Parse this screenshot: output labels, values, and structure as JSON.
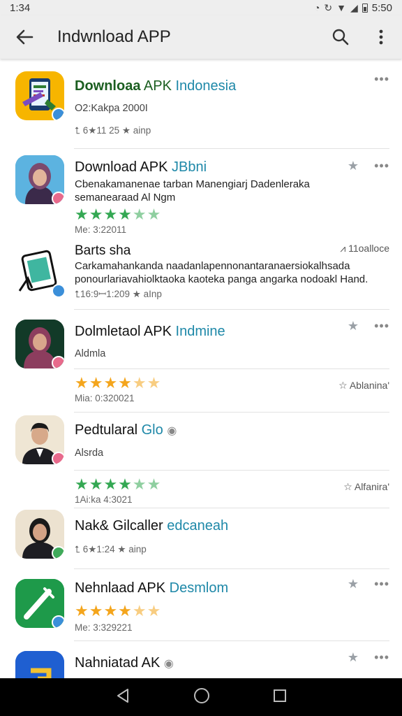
{
  "status_bar": {
    "time": "1:34",
    "clock": "5:50"
  },
  "app_bar": {
    "title": "Indwnload APP"
  },
  "items": [
    {
      "title_a": "Downloaa",
      "title_b": " APK ",
      "title_c": "Indonesia",
      "sub": "O2:Kakpa 2000I",
      "meta": "⮤ 6★11 25  ★ ainp"
    },
    {
      "title_a": "Download APK ",
      "title_b": "JBbni",
      "desc1": "Cbenakamanenae tarban Manengiarj Dadenleraka",
      "desc2": "semanearaad Al Ngm",
      "rating_text": "Me: 3:22011"
    },
    {
      "title": "Barts sha",
      "tag": "⩘ 11oalloce",
      "desc1": "Carkamahankanda naadanlapennonantaranaersiokalhsada",
      "desc2": "ponourlariavahiolktaoka kaoteka panga angarka nodoakl Hand.",
      "meta": "⮤16:9ꟷ1:209 ★ aInp"
    },
    {
      "title_a": "Dolmletaol APK ",
      "title_b": "Indmine",
      "sub": "Aldmla",
      "rating_text": "Mia: 0:320021",
      "tag": "☆ Ablanina'"
    },
    {
      "title_a": "Pedtularal ",
      "title_b": "Glo",
      "sub": "Alsrda",
      "rating_text": "1Ai:ka 4:3021",
      "tag": "☆ Alfanira'"
    },
    {
      "title_a": "Nak& Gilcaller ",
      "title_b": "edcaneah",
      "meta": "⮤ 6★1:24  ★ ainp"
    },
    {
      "title_a": "Nehnlaad APK ",
      "title_b": "Desmlom",
      "rating_text": "Me: 3:329221"
    },
    {
      "title_a": "Nahniatad AK",
      "title_b": ""
    }
  ],
  "colors": {
    "accent": "#1e88a8",
    "green_star": "#34a853",
    "gold_star": "#f4a51c",
    "app_bar": "#eeeeee"
  }
}
